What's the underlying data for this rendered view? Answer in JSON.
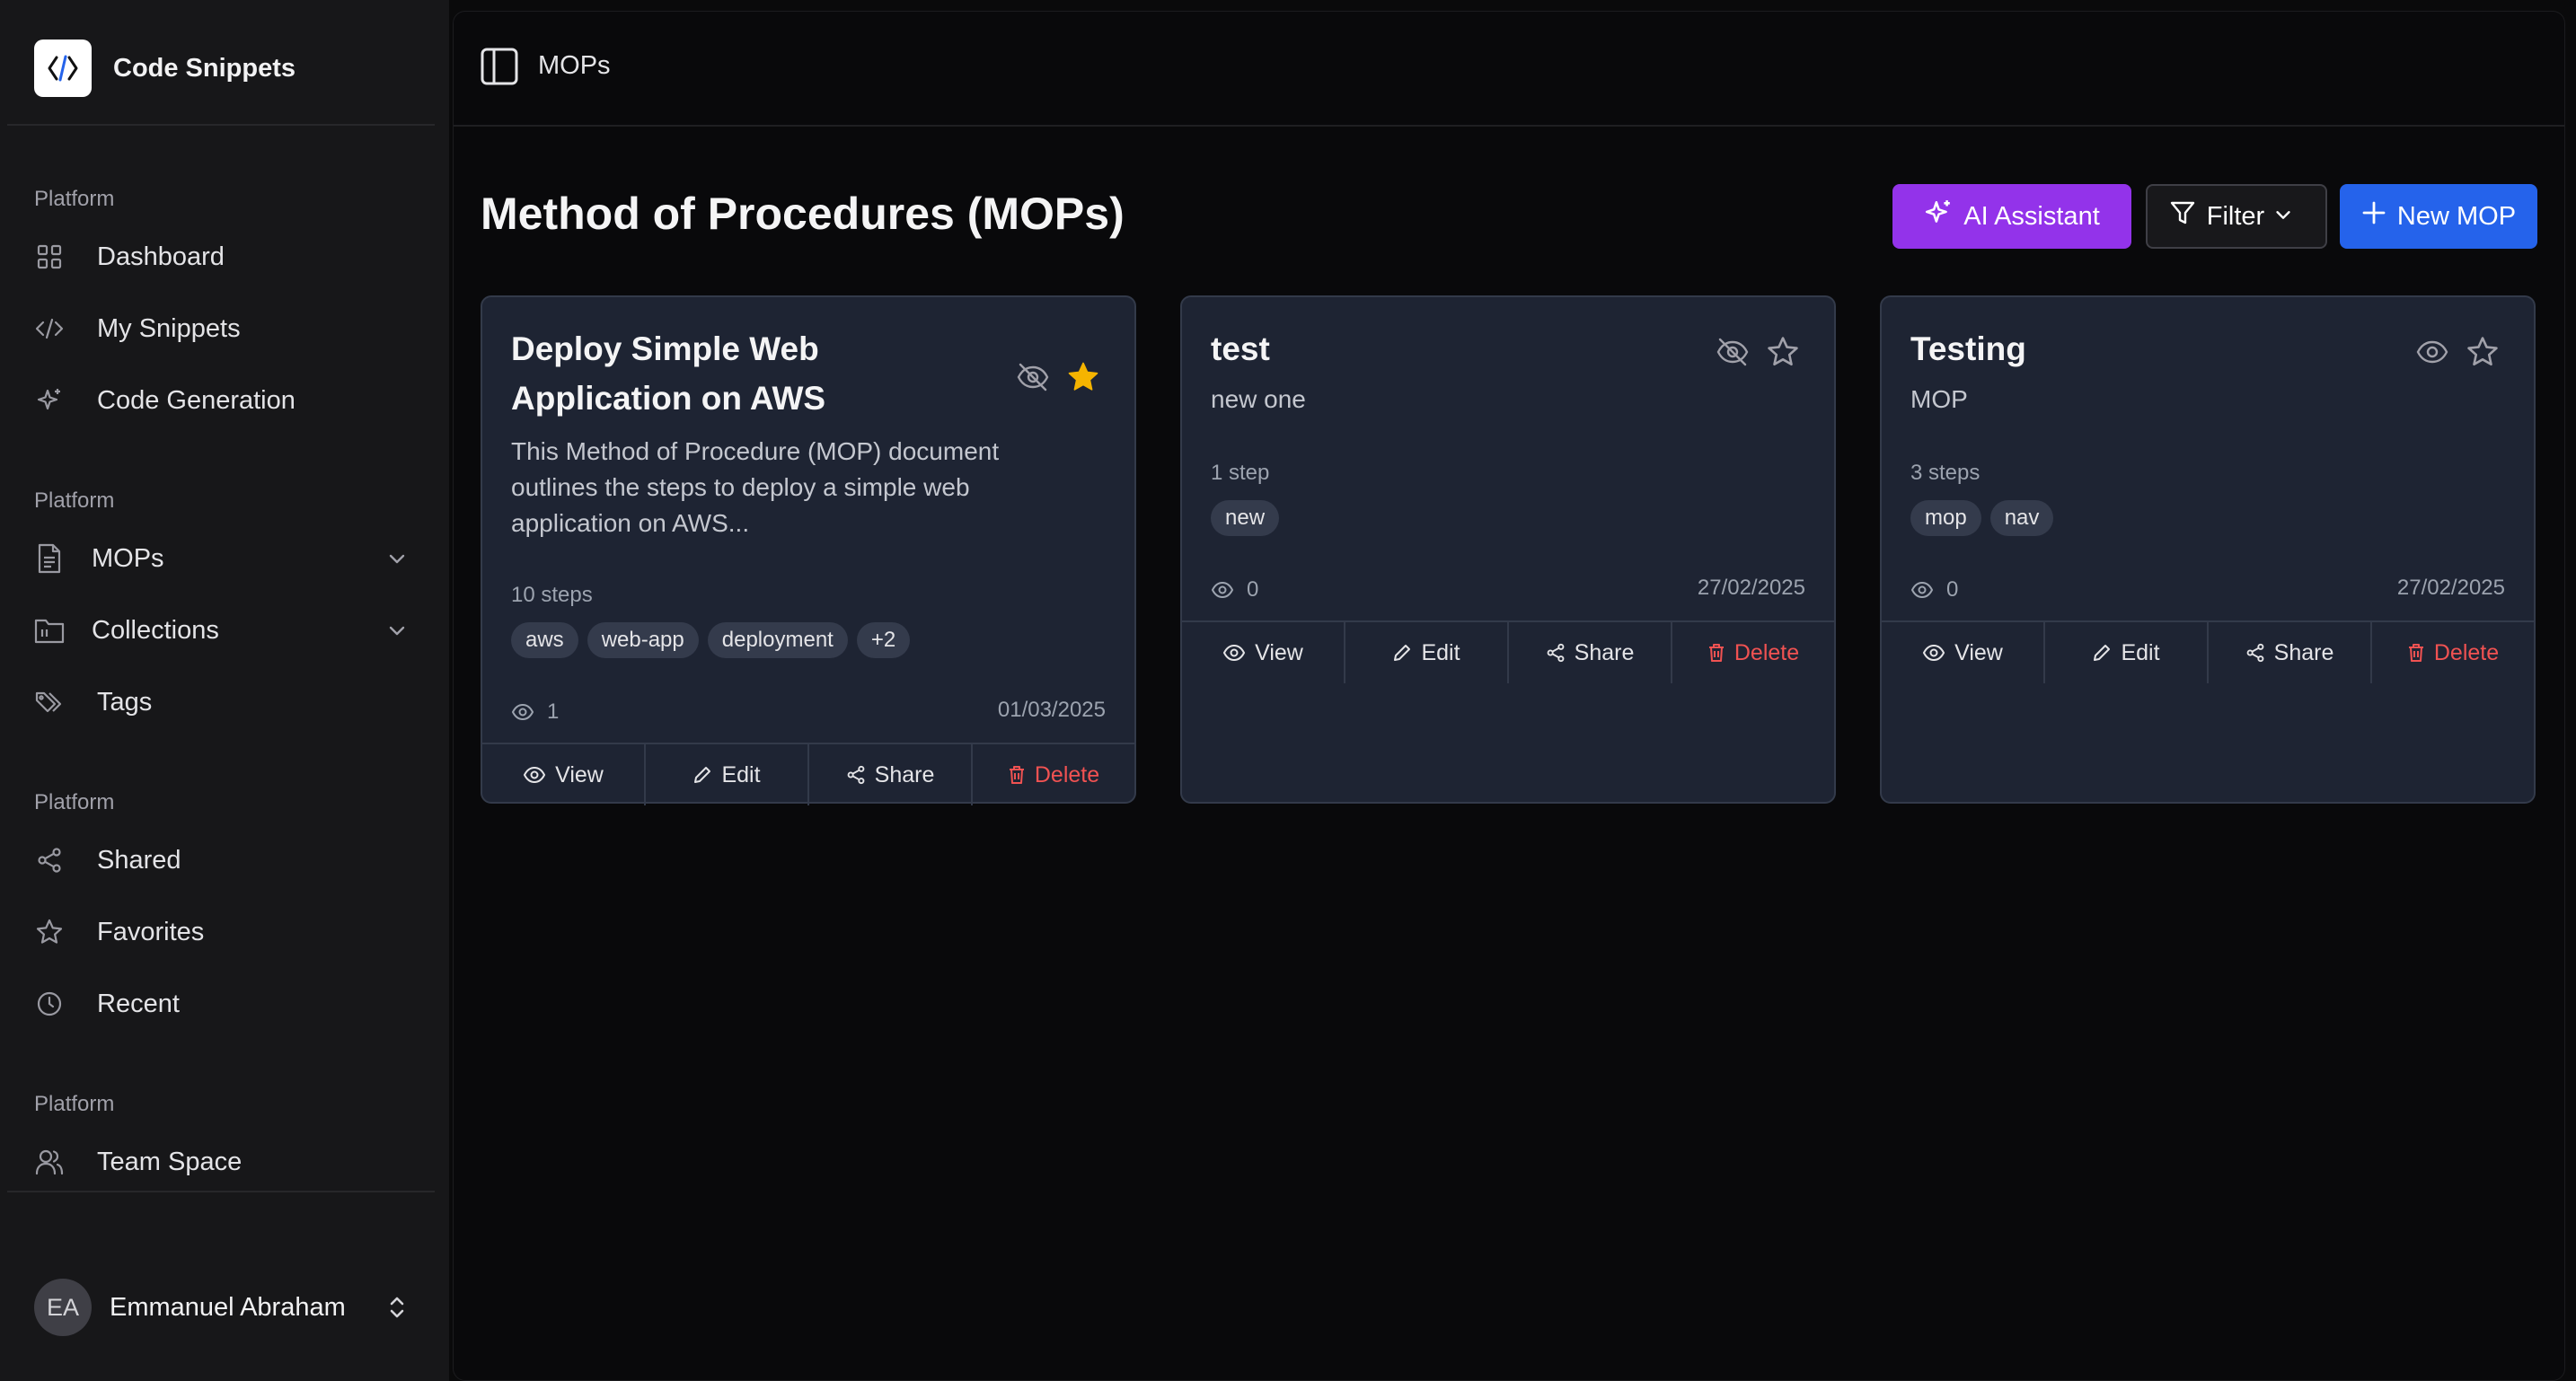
{
  "app": {
    "name": "Code Snippets"
  },
  "sidebar": {
    "sections": [
      {
        "label": "Platform",
        "items": [
          {
            "label": "Dashboard",
            "icon": "grid-icon"
          },
          {
            "label": "My Snippets",
            "icon": "code-icon"
          },
          {
            "label": "Code Generation",
            "icon": "sparkles-icon"
          }
        ]
      },
      {
        "label": "Platform",
        "items": [
          {
            "label": "MOPs",
            "icon": "document-icon",
            "expandable": true
          },
          {
            "label": "Collections",
            "icon": "folder-icon",
            "expandable": true
          },
          {
            "label": "Tags",
            "icon": "tags-icon"
          }
        ]
      },
      {
        "label": "Platform",
        "items": [
          {
            "label": "Shared",
            "icon": "share-icon"
          },
          {
            "label": "Favorites",
            "icon": "star-icon"
          },
          {
            "label": "Recent",
            "icon": "clock-icon"
          }
        ]
      },
      {
        "label": "Platform",
        "items": [
          {
            "label": "Team Space",
            "icon": "users-icon"
          }
        ]
      }
    ],
    "user": {
      "initials": "EA",
      "name": "Emmanuel Abraham"
    }
  },
  "header": {
    "breadcrumb": "MOPs"
  },
  "page": {
    "title": "Method of Procedures (MOPs)",
    "buttons": {
      "ai": "AI Assistant",
      "filter": "Filter",
      "new": "New MOP"
    }
  },
  "actions": {
    "view": "View",
    "edit": "Edit",
    "share": "Share",
    "delete": "Delete"
  },
  "cards": [
    {
      "title": "Deploy Simple Web Application on AWS",
      "description": "This Method of Procedure (MOP) document outlines the steps to deploy a simple web application on AWS...",
      "steps": "10 steps",
      "tags": [
        "aws",
        "web-app",
        "deployment",
        "+2"
      ],
      "views": "1",
      "date": "01/03/2025",
      "visibility_icon": "eye-off-icon",
      "favorite": true
    },
    {
      "title": "test",
      "description": "new one",
      "steps": "1 step",
      "tags": [
        "new"
      ],
      "views": "0",
      "date": "27/02/2025",
      "visibility_icon": "eye-off-icon",
      "favorite": false
    },
    {
      "title": "Testing",
      "description": "MOP",
      "steps": "3 steps",
      "tags": [
        "mop",
        "nav"
      ],
      "views": "0",
      "date": "27/02/2025",
      "visibility_icon": "eye-icon",
      "favorite": false
    }
  ],
  "colors": {
    "accent_purple": "#9333ea",
    "accent_blue": "#2563eb",
    "favorite_star": "#f5b400",
    "danger": "#f05252",
    "card_bg": "#1e2433"
  }
}
